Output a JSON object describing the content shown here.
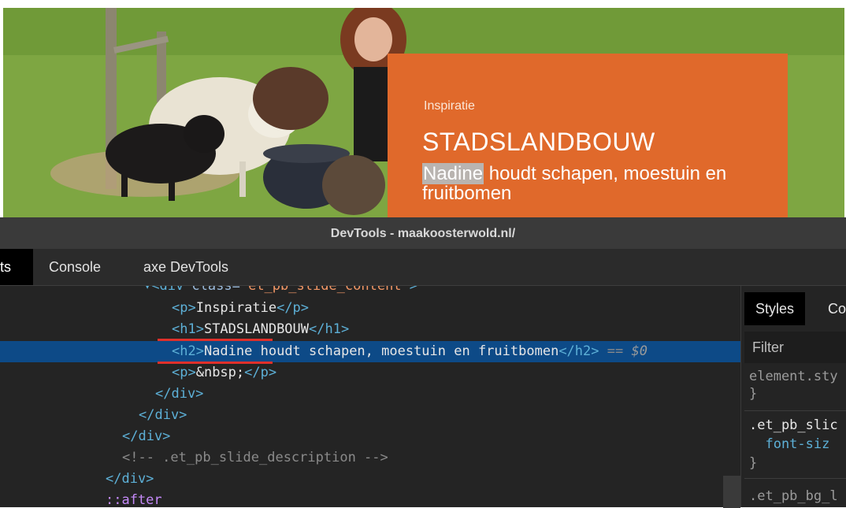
{
  "hero": {
    "kicker": "Inspiratie",
    "title": "STADSLANDBOUW",
    "subtitle_highlight": "Nadine",
    "subtitle_rest": " houdt schapen, moestuin en fruitbomen",
    "overlay_color": "#e0692b"
  },
  "devtools": {
    "window_title": "DevTools - maakoosterwold.nl/",
    "tabs": {
      "elements": "ts",
      "console": "Console",
      "axe": "axe DevTools"
    },
    "tree": {
      "l0_open": "▾<div",
      "l0_attr": " class=",
      "l0_val": "\"et_pb_slide_content\"",
      "l0_close": ">",
      "l1_open": "<p>",
      "l1_text": "Inspiratie",
      "l1_close": "</p>",
      "l2_open": "<h1>",
      "l2_text": "STADSLANDBOUW",
      "l2_close": "</h1>",
      "l3_open": "<h2>",
      "l3_text_a": "Nadine",
      "l3_text_b": " houdt schapen, moestuin en fruitbomen",
      "l3_close": "</h2>",
      "l3_eq": " == ",
      "l3_dollar": "$0",
      "l4_open": "<p>",
      "l4_text": "&nbsp;",
      "l4_close": "</p>",
      "l5": "</div>",
      "l6": "</div>",
      "l7": "</div>",
      "l8": "<!-- .et_pb_slide_description -->",
      "l9": "</div>",
      "l10": "::after"
    },
    "styles": {
      "tab_styles": "Styles",
      "tab_computed": "Co",
      "filter_placeholder": "Filter",
      "rule1_selector": "element.sty",
      "rule1_close": "}",
      "rule2_selector": ".et_pb_slic",
      "rule2_prop": "  font-siz",
      "rule2_close": "}",
      "rule3_selector": ".et_pb_bg_l"
    }
  }
}
